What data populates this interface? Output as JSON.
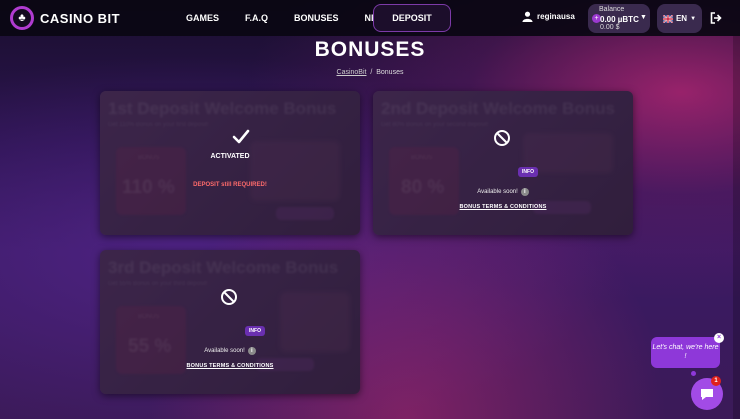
{
  "header": {
    "logo_text": "CASINO BIT",
    "nav": [
      "GAMES",
      "F.A.Q",
      "BONUSES",
      "NEWS"
    ],
    "deposit_label": "DEPOSIT",
    "username": "reginausa",
    "balance_label": "Balance",
    "balance_btc": "0.00 µBTC",
    "balance_usd": "0.00 $",
    "language": "EN"
  },
  "page": {
    "title": "BONUSES",
    "breadcrumb_home": "CasinoBit",
    "breadcrumb_sep": "/",
    "breadcrumb_current": "Bonuses"
  },
  "cards": [
    {
      "bg_title": "1st Deposit Welcome Bonus",
      "bg_subtitle": "Get 110% Bonus on your first deposit!",
      "bg_label": "BONUS",
      "bg_percent": "110 %",
      "status": "ACTIVATED",
      "warning": "DEPOSIT still REQUIRED!"
    },
    {
      "bg_title": "2nd Deposit Welcome Bonus",
      "bg_subtitle": "Get 80% Bonus on your second deposit!",
      "bg_label": "BONUS",
      "bg_percent": "80 %",
      "info_badge": "INFO",
      "soon": "Available soon!",
      "terms": "BONUS TERMS & CONDITIONS"
    },
    {
      "bg_title": "3rd Deposit Welcome Bonus",
      "bg_subtitle": "Get 55% Bonus on your third deposit!",
      "bg_label": "BONUS",
      "bg_percent": "55 %",
      "info_badge": "INFO",
      "soon": "Available soon!",
      "terms": "BONUS TERMS & CONDITIONS"
    }
  ],
  "chat": {
    "bubble_text": "Let's chat, we're here !",
    "unread": "1"
  },
  "colors": {
    "accent": "#8e38d9",
    "warning": "#ff6b6b",
    "badge": "#6a2fb0"
  }
}
